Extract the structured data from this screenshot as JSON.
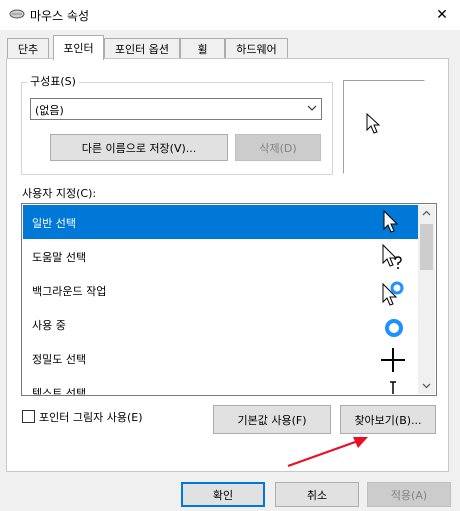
{
  "window": {
    "title": "마우스 속성",
    "close_glyph": "✕"
  },
  "tabs": [
    {
      "label": "단추"
    },
    {
      "label": "포인터"
    },
    {
      "label": "포인터 옵션"
    },
    {
      "label": "휠"
    },
    {
      "label": "하드웨어"
    }
  ],
  "scheme": {
    "label": "구성표(S)",
    "selected": "(없음)",
    "save_as_label": "다른 이름으로 저장(V)...",
    "delete_label": "삭제(D)"
  },
  "customize": {
    "label": "사용자 지정(C):",
    "items": [
      {
        "label": "일반 선택",
        "icon": "arrow-cursor-icon",
        "selected": true
      },
      {
        "label": "도움말 선택",
        "icon": "help-cursor-icon"
      },
      {
        "label": "백그라운드 작업",
        "icon": "working-in-background-cursor-icon"
      },
      {
        "label": "사용 중",
        "icon": "busy-cursor-icon"
      },
      {
        "label": "정밀도 선택",
        "icon": "crosshair-cursor-icon"
      },
      {
        "label": "텍스트 선택",
        "icon": "text-select-cursor-icon"
      }
    ]
  },
  "options": {
    "shadow_label": "포인터 그림자 사용(E)",
    "shadow_checked": false,
    "default_label": "기본값 사용(F)",
    "browse_label": "찾아보기(B)..."
  },
  "footer": {
    "ok_label": "확인",
    "cancel_label": "취소",
    "apply_label": "적용(A)"
  },
  "colors": {
    "accent": "#0078d7",
    "annotation_arrow": "#e81123"
  }
}
